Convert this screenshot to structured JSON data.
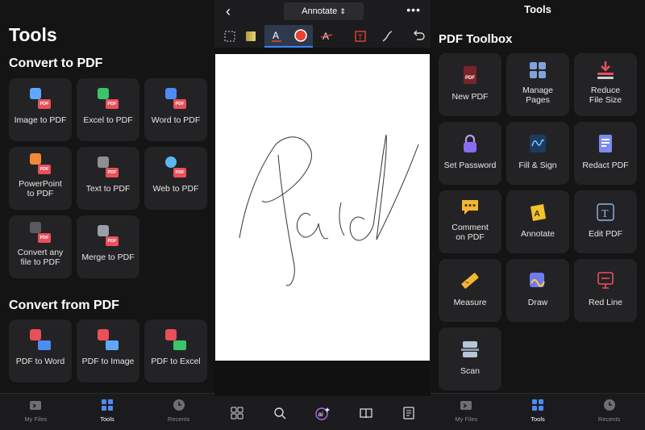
{
  "left": {
    "title": "Tools",
    "convert_to": {
      "heading": "Convert to PDF",
      "items": [
        "Image to PDF",
        "Excel to PDF",
        "Word to PDF",
        "PowerPoint to PDF",
        "Text to PDF",
        "Web to PDF",
        "Convert any file to PDF",
        "Merge to PDF"
      ]
    },
    "convert_from": {
      "heading": "Convert from PDF",
      "items": [
        "PDF to Word",
        "PDF to Image",
        "PDF to Excel"
      ]
    },
    "badge": "PDF",
    "tabs": [
      "My Files",
      "Tools",
      "Recents"
    ]
  },
  "middle": {
    "mode_label": "Annotate",
    "mode_chevron": "⌃",
    "back": "‹",
    "more": "•••",
    "colors": {
      "highlight": "#c9b458",
      "pen": "#e8432f",
      "accent": "#3a86ff",
      "stamp": "#e8432f"
    }
  },
  "right": {
    "header": "Tools",
    "title": "PDF Toolbox",
    "items": [
      "New PDF",
      "Manage Pages",
      "Reduce File Size",
      "Set Password",
      "Fill & Sign",
      "Redact PDF",
      "Comment on PDF",
      "Annotate",
      "Edit PDF",
      "Measure",
      "Draw",
      "Red Line",
      "Scan"
    ],
    "tabs": [
      "My Files",
      "Tools",
      "Recents"
    ]
  }
}
